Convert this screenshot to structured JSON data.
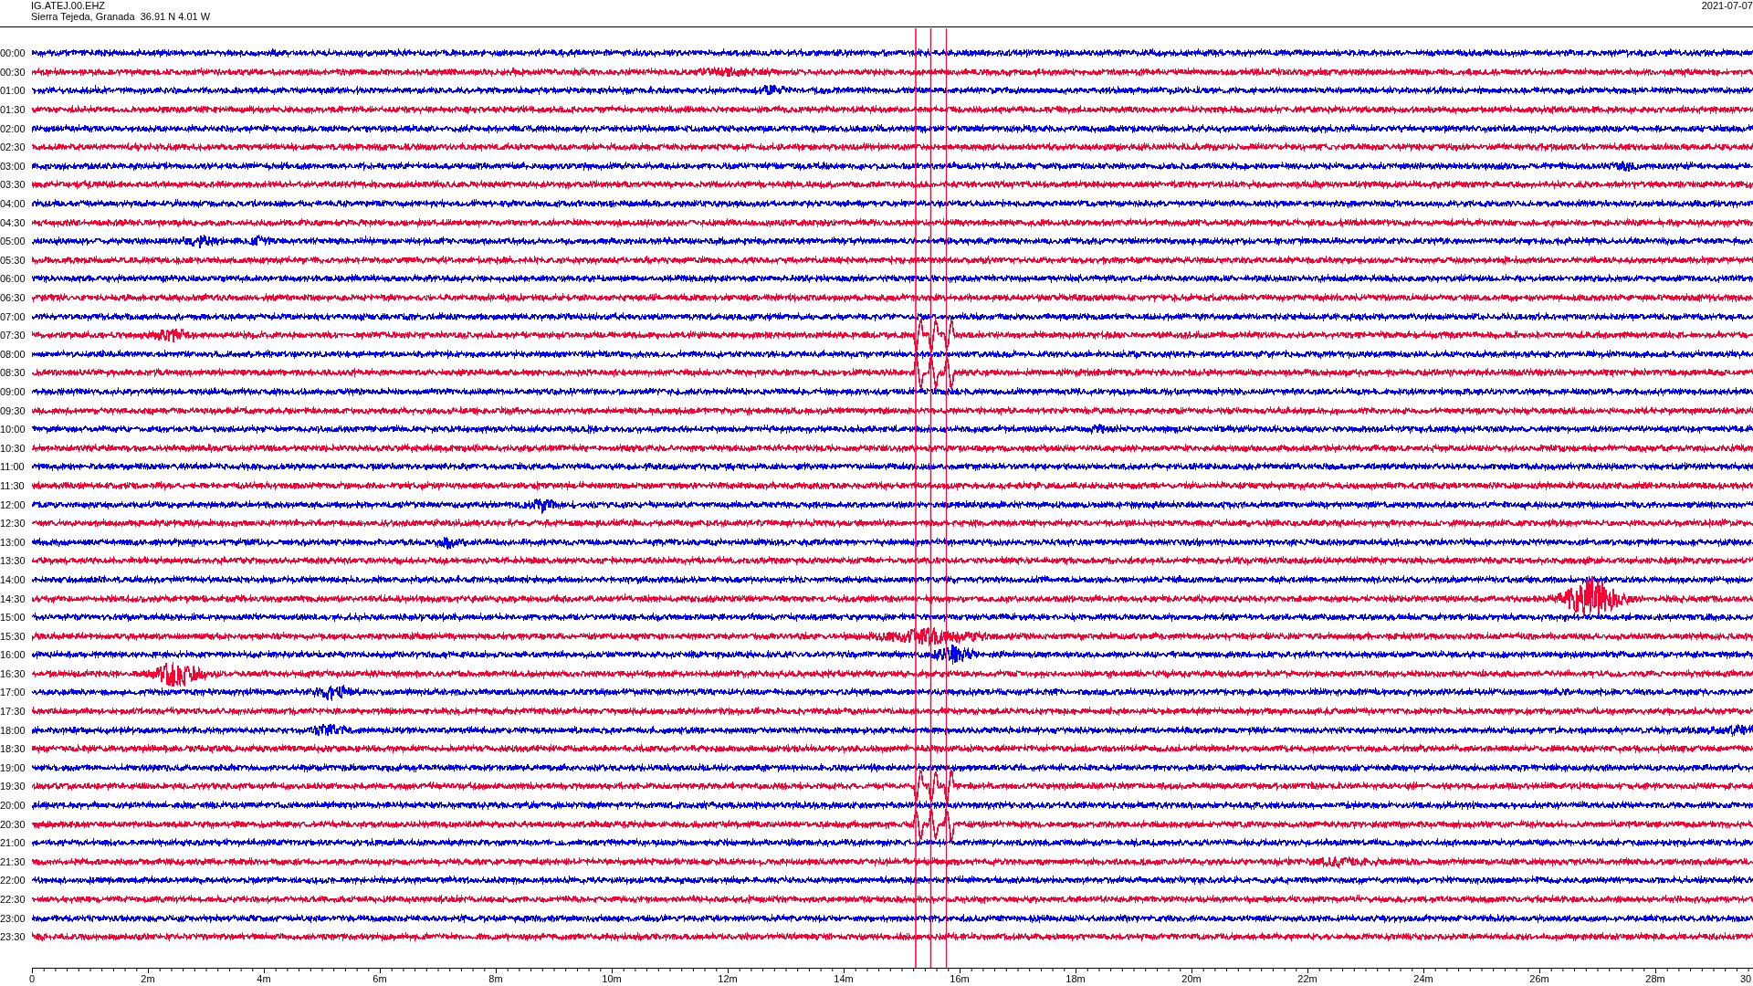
{
  "header": {
    "station": "IG.ATEJ.00.EHZ",
    "location": "Sierra Tejeda, Granada  36.91 N 4.01 W",
    "date": "2021-07-07"
  },
  "rows": [
    {
      "time": "00:00",
      "color": "#0000ff"
    },
    {
      "time": "00:30",
      "color": "#ff0033"
    },
    {
      "time": "01:00",
      "color": "#0000ff"
    },
    {
      "time": "01:30",
      "color": "#ff0033"
    },
    {
      "time": "02:00",
      "color": "#0000ff"
    },
    {
      "time": "02:30",
      "color": "#ff0033"
    },
    {
      "time": "03:00",
      "color": "#0000ff"
    },
    {
      "time": "03:30",
      "color": "#ff0033"
    },
    {
      "time": "04:00",
      "color": "#0000ff"
    },
    {
      "time": "04:30",
      "color": "#ff0033"
    },
    {
      "time": "05:00",
      "color": "#0000ff"
    },
    {
      "time": "05:30",
      "color": "#ff0033"
    },
    {
      "time": "06:00",
      "color": "#0000ff"
    },
    {
      "time": "06:30",
      "color": "#ff0033"
    },
    {
      "time": "07:00",
      "color": "#0000ff"
    },
    {
      "time": "07:30",
      "color": "#ff0033"
    },
    {
      "time": "08:00",
      "color": "#0000ff"
    },
    {
      "time": "08:30",
      "color": "#ff0033"
    },
    {
      "time": "09:00",
      "color": "#0000ff"
    },
    {
      "time": "09:30",
      "color": "#ff0033"
    },
    {
      "time": "10:00",
      "color": "#0000ff"
    },
    {
      "time": "10:30",
      "color": "#ff0033"
    },
    {
      "time": "11:00",
      "color": "#0000ff"
    },
    {
      "time": "11:30",
      "color": "#ff0033"
    },
    {
      "time": "12:00",
      "color": "#0000ff"
    },
    {
      "time": "12:30",
      "color": "#ff0033"
    },
    {
      "time": "13:00",
      "color": "#0000ff"
    },
    {
      "time": "13:30",
      "color": "#ff0033"
    },
    {
      "time": "14:00",
      "color": "#0000ff"
    },
    {
      "time": "14:30",
      "color": "#ff0033"
    },
    {
      "time": "15:00",
      "color": "#0000ff"
    },
    {
      "time": "15:30",
      "color": "#ff0033"
    },
    {
      "time": "16:00",
      "color": "#0000ff"
    },
    {
      "time": "16:30",
      "color": "#ff0033"
    },
    {
      "time": "17:00",
      "color": "#0000ff"
    },
    {
      "time": "17:30",
      "color": "#ff0033"
    },
    {
      "time": "18:00",
      "color": "#0000ff"
    },
    {
      "time": "18:30",
      "color": "#ff0033"
    },
    {
      "time": "19:00",
      "color": "#0000ff"
    },
    {
      "time": "19:30",
      "color": "#ff0033"
    },
    {
      "time": "20:00",
      "color": "#0000ff"
    },
    {
      "time": "20:30",
      "color": "#ff0033"
    },
    {
      "time": "21:00",
      "color": "#0000ff"
    },
    {
      "time": "21:30",
      "color": "#ff0033"
    },
    {
      "time": "22:00",
      "color": "#0000ff"
    },
    {
      "time": "22:30",
      "color": "#ff0033"
    },
    {
      "time": "23:00",
      "color": "#0000ff"
    },
    {
      "time": "23:30",
      "color": "#ff0033"
    }
  ],
  "x_axis": {
    "ticks": [
      "0",
      "2m",
      "4m",
      "6m",
      "8m",
      "10m",
      "12m",
      "14m",
      "16m",
      "18m",
      "20m",
      "22m",
      "24m",
      "26m",
      "28m",
      "30"
    ]
  }
}
